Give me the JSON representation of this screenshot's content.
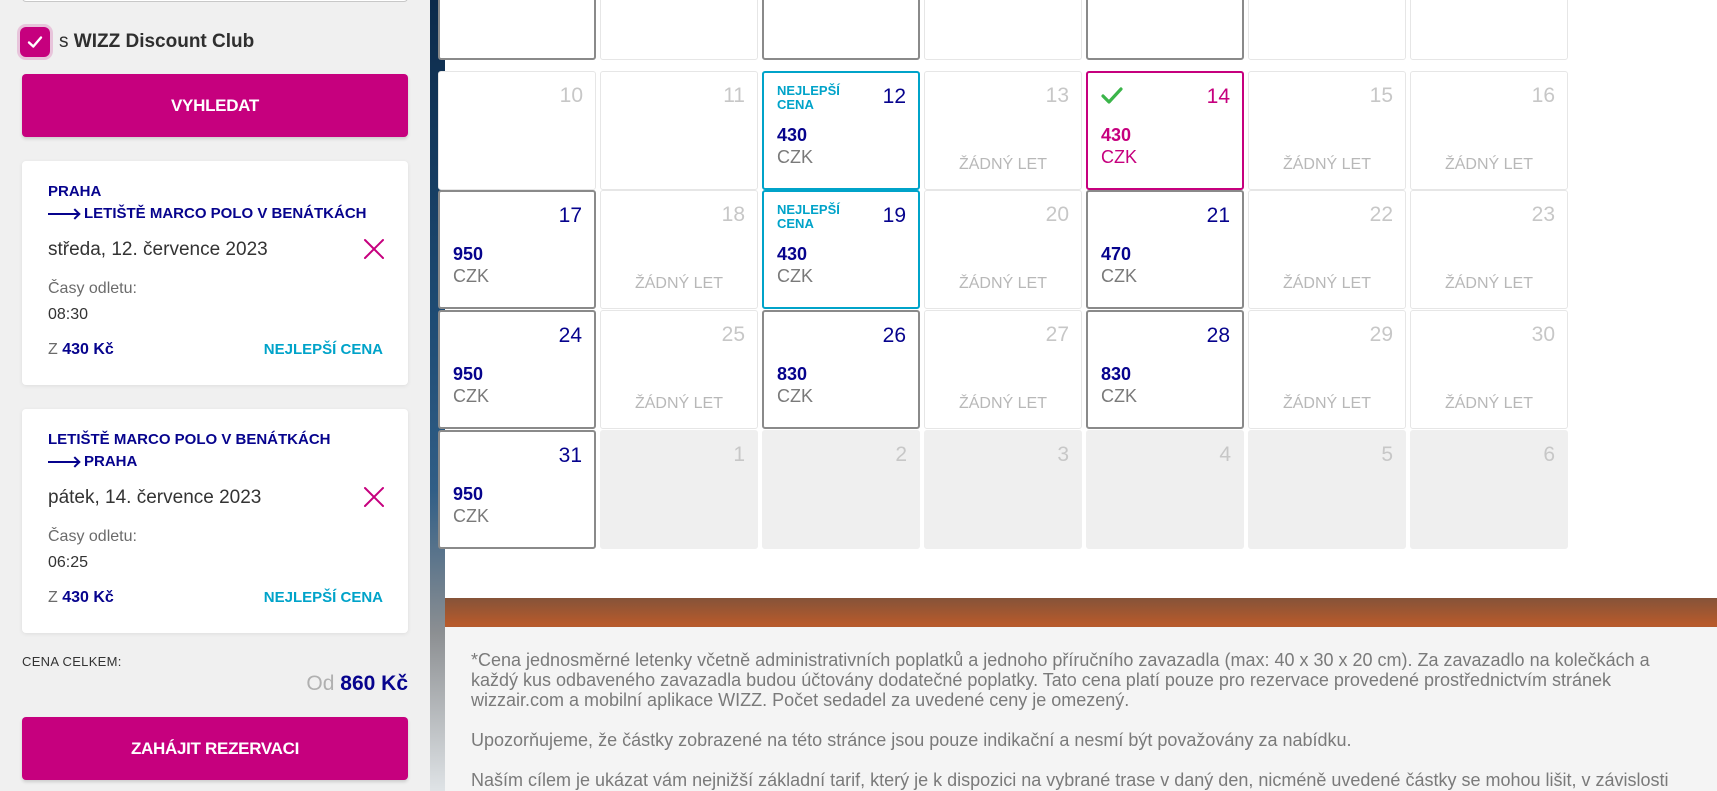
{
  "sidebar": {
    "discount": {
      "prefix": "s",
      "label": "WIZZ Discount Club",
      "checked": true
    },
    "search_button": "VYHLEDAT",
    "outbound": {
      "from": "PRAHA",
      "to": "LETIŠTĚ MARCO POLO V BENÁTKÁCH",
      "date": "středa, 12. července 2023",
      "times_label": "Časy odletu:",
      "time": "08:30",
      "price_prefix": "Z",
      "price": "430 Kč",
      "best_label": "NEJLEPŠÍ CENA"
    },
    "return": {
      "from": "LETIŠTĚ MARCO POLO V BENÁTKÁCH",
      "to": "PRAHA",
      "date": "pátek, 14. července 2023",
      "times_label": "Časy odletu:",
      "time": "06:25",
      "price_prefix": "Z",
      "price": "430 Kč",
      "best_label": "NEJLEPŠÍ CENA"
    },
    "total_label": "CENA CELKEM:",
    "total_prefix": "Od",
    "total_value": "860 Kč",
    "book_button": "ZAHÁJIT REZERVACI"
  },
  "calendar": {
    "best_label_line1": "NEJLEPŠÍ",
    "best_label_line2": "CENA",
    "no_flight_label": "ŽÁDNÝ LET",
    "currency": "CZK",
    "rows": [
      [
        {
          "state": "avail"
        },
        {
          "state": "empty"
        },
        {
          "state": "avail"
        },
        {
          "state": "empty"
        },
        {
          "state": "avail"
        },
        {
          "state": "empty"
        },
        {
          "state": "empty"
        }
      ],
      [
        {
          "day": "10",
          "state": "empty"
        },
        {
          "day": "11",
          "state": "empty"
        },
        {
          "day": "12",
          "state": "best",
          "price": "430"
        },
        {
          "day": "13",
          "state": "noflight"
        },
        {
          "day": "14",
          "state": "selected",
          "price": "430"
        },
        {
          "day": "15",
          "state": "noflight"
        },
        {
          "day": "16",
          "state": "noflight"
        }
      ],
      [
        {
          "day": "17",
          "state": "avail",
          "price": "950"
        },
        {
          "day": "18",
          "state": "noflight"
        },
        {
          "day": "19",
          "state": "best",
          "price": "430"
        },
        {
          "day": "20",
          "state": "noflight"
        },
        {
          "day": "21",
          "state": "avail",
          "price": "470"
        },
        {
          "day": "22",
          "state": "noflight"
        },
        {
          "day": "23",
          "state": "noflight"
        }
      ],
      [
        {
          "day": "24",
          "state": "avail",
          "price": "950"
        },
        {
          "day": "25",
          "state": "noflight"
        },
        {
          "day": "26",
          "state": "avail",
          "price": "830"
        },
        {
          "day": "27",
          "state": "noflight"
        },
        {
          "day": "28",
          "state": "avail",
          "price": "830"
        },
        {
          "day": "29",
          "state": "noflight"
        },
        {
          "day": "30",
          "state": "noflight"
        }
      ],
      [
        {
          "day": "31",
          "state": "avail",
          "price": "950"
        },
        {
          "day": "1",
          "state": "other"
        },
        {
          "day": "2",
          "state": "other"
        },
        {
          "day": "3",
          "state": "other"
        },
        {
          "day": "4",
          "state": "other"
        },
        {
          "day": "5",
          "state": "other"
        },
        {
          "day": "6",
          "state": "other"
        }
      ]
    ]
  },
  "disclaimer": {
    "p1": "*Cena jednosměrné letenky včetně administrativních poplatků a jednoho příručního zavazadla (max: 40 x 30 x 20 cm). Za zavazadlo na kolečkách a každý kus odbaveného zavazadla budou účtovány dodatečné poplatky. Tato cena platí pouze pro rezervace provedené prostřednictvím stránek wizzair.com a mobilní aplikace WIZZ. Počet sedadel za uvedené ceny je omezený.",
    "p2": "Upozorňujeme, že částky zobrazené na této stránce jsou pouze indikační a nesmí být považovány za nabídku.",
    "p3": "Naším cílem je ukázat vám nejnižší základní tarif, který je k dispozici na vybrané trase v daný den, nicméně uvedené částky se mohou lišit, v závislosti"
  },
  "colors": {
    "brand": "#c6007e",
    "navy": "#06038d",
    "best": "#00a3c9"
  }
}
